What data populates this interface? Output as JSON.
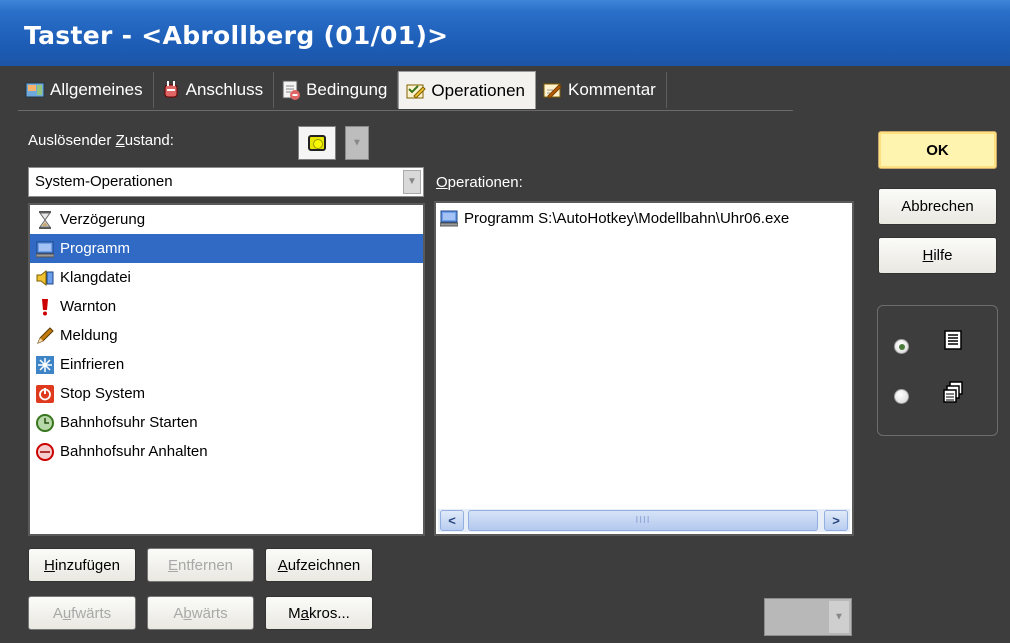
{
  "window": {
    "title": "Taster - <Abrollberg (01/01)>"
  },
  "tabs": [
    {
      "label": "Allgemeines",
      "icon": "general-settings-icon",
      "active": false
    },
    {
      "label": "Anschluss",
      "icon": "plug-icon",
      "active": false
    },
    {
      "label": "Bedingung",
      "icon": "condition-icon",
      "active": false
    },
    {
      "label": "Operationen",
      "icon": "operations-icon",
      "active": true
    },
    {
      "label": "Kommentar",
      "icon": "comment-icon",
      "active": false
    }
  ],
  "trigger": {
    "label_prefix": "Auslösender ",
    "label_hotkey": "Z",
    "label_suffix": "ustand:",
    "state_icon": "yellow-led-icon"
  },
  "category_combo": {
    "value": "System-Operationen"
  },
  "available_operations": [
    {
      "label": "Verzögerung",
      "icon": "hourglass-icon",
      "selected": false
    },
    {
      "label": "Programm",
      "icon": "computer-icon",
      "selected": true
    },
    {
      "label": "Klangdatei",
      "icon": "sound-file-icon",
      "selected": false
    },
    {
      "label": "Warnton",
      "icon": "exclamation-icon",
      "selected": false
    },
    {
      "label": "Meldung",
      "icon": "pencil-icon",
      "selected": false
    },
    {
      "label": "Einfrieren",
      "icon": "snowflake-icon",
      "selected": false
    },
    {
      "label": "Stop System",
      "icon": "power-icon",
      "selected": false
    },
    {
      "label": "Bahnhofsuhr Starten",
      "icon": "green-clock-icon",
      "selected": false
    },
    {
      "label": "Bahnhofsuhr Anhalten",
      "icon": "red-clock-icon",
      "selected": false
    }
  ],
  "operations_panel": {
    "label_hotkey": "O",
    "label_suffix": "perationen:",
    "items": [
      {
        "label": "Programm S:\\AutoHotkey\\Modellbahn\\Uhr06.exe",
        "icon": "computer-icon"
      }
    ],
    "scroll_thumb_grip": "IIII"
  },
  "buttons": {
    "ok": "OK",
    "cancel": "Abbrechen",
    "help_hotkey": "H",
    "help_rest": "ilfe",
    "add_hotkey": "H",
    "add_rest": "inzufügen",
    "remove_hotkey": "E",
    "remove_rest": "ntfernen",
    "record_hotkey": "A",
    "record_rest": "ufzeichnen",
    "up_pre": "A",
    "up_hotkey": "u",
    "up_rest": "fwärts",
    "down_pre": "A",
    "down_hotkey": "b",
    "down_rest": "wärts",
    "macros_pre": "M",
    "macros_hotkey": "a",
    "macros_rest": "kros..."
  },
  "view_mode": {
    "options": [
      {
        "icon": "list-view-icon",
        "checked": true
      },
      {
        "icon": "multi-window-icon",
        "checked": false
      }
    ]
  },
  "colors": {
    "titlebar": "#1e5fb9",
    "selection": "#316ac5",
    "ok_button": "#fff3b0",
    "background": "#3d3d3d"
  }
}
